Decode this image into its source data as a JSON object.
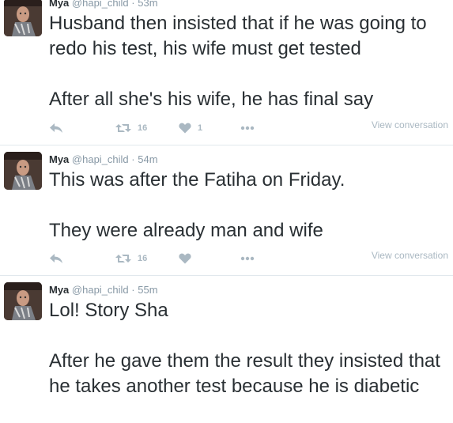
{
  "tweets": [
    {
      "name": "Mya",
      "handle": "@hapi_child",
      "separator": "·",
      "time": "53m",
      "text": "Husband then insisted that if he was going to redo his test, his wife must get tested\n\nAfter all she's his wife, he has final say",
      "retweet_count": "16",
      "like_count": "1",
      "view_conversation": "View conversation"
    },
    {
      "name": "Mya",
      "handle": "@hapi_child",
      "separator": "·",
      "time": "54m",
      "text": "This was after the Fatiha on Friday.\n\nThey were already man and wife",
      "retweet_count": "16",
      "like_count": "",
      "view_conversation": "View conversation"
    },
    {
      "name": "Mya",
      "handle": "@hapi_child",
      "separator": "·",
      "time": "55m",
      "text": "Lol! Story Sha\n\nAfter he gave them the result they insisted that he takes another test because he is diabetic"
    }
  ],
  "icons": {
    "reply": "reply-icon",
    "retweet": "retweet-icon",
    "like": "heart-icon",
    "more": "more-icon"
  },
  "colors": {
    "text": "#292f33",
    "muted": "#8899a6",
    "action": "#aab8c2",
    "divider": "#e1e8ed"
  }
}
